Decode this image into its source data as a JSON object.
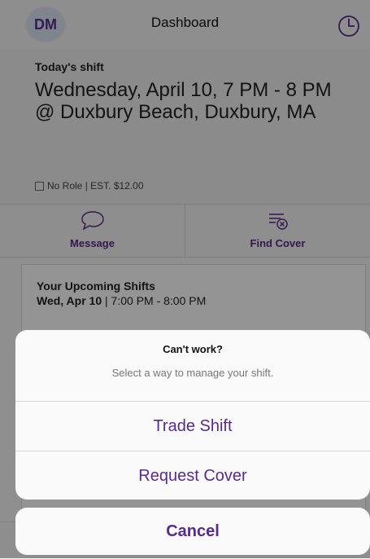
{
  "header": {
    "avatar_initials": "DM",
    "title": "Dashboard"
  },
  "shift": {
    "label": "Today's shift",
    "datetime": "Wednesday, April 10, 7 PM - 8 PM",
    "location": "@ Duxbury Beach, Duxbury, MA",
    "meta": "No Role | EST. $12.00"
  },
  "actions": {
    "message_label": "Message",
    "find_cover_label": "Find Cover"
  },
  "upcoming": {
    "title": "Your Upcoming Shifts",
    "row_date": "Wed, Apr 10",
    "row_time": " | 7:00 PM - 8:00 PM"
  },
  "sheet": {
    "title": "Can't work?",
    "message": "Select a way to manage your shift.",
    "trade_label": "Trade Shift",
    "request_label": "Request Cover",
    "cancel_label": "Cancel"
  },
  "colors": {
    "accent": "#5a2a8a",
    "avatar_text": "#5c2e91"
  }
}
